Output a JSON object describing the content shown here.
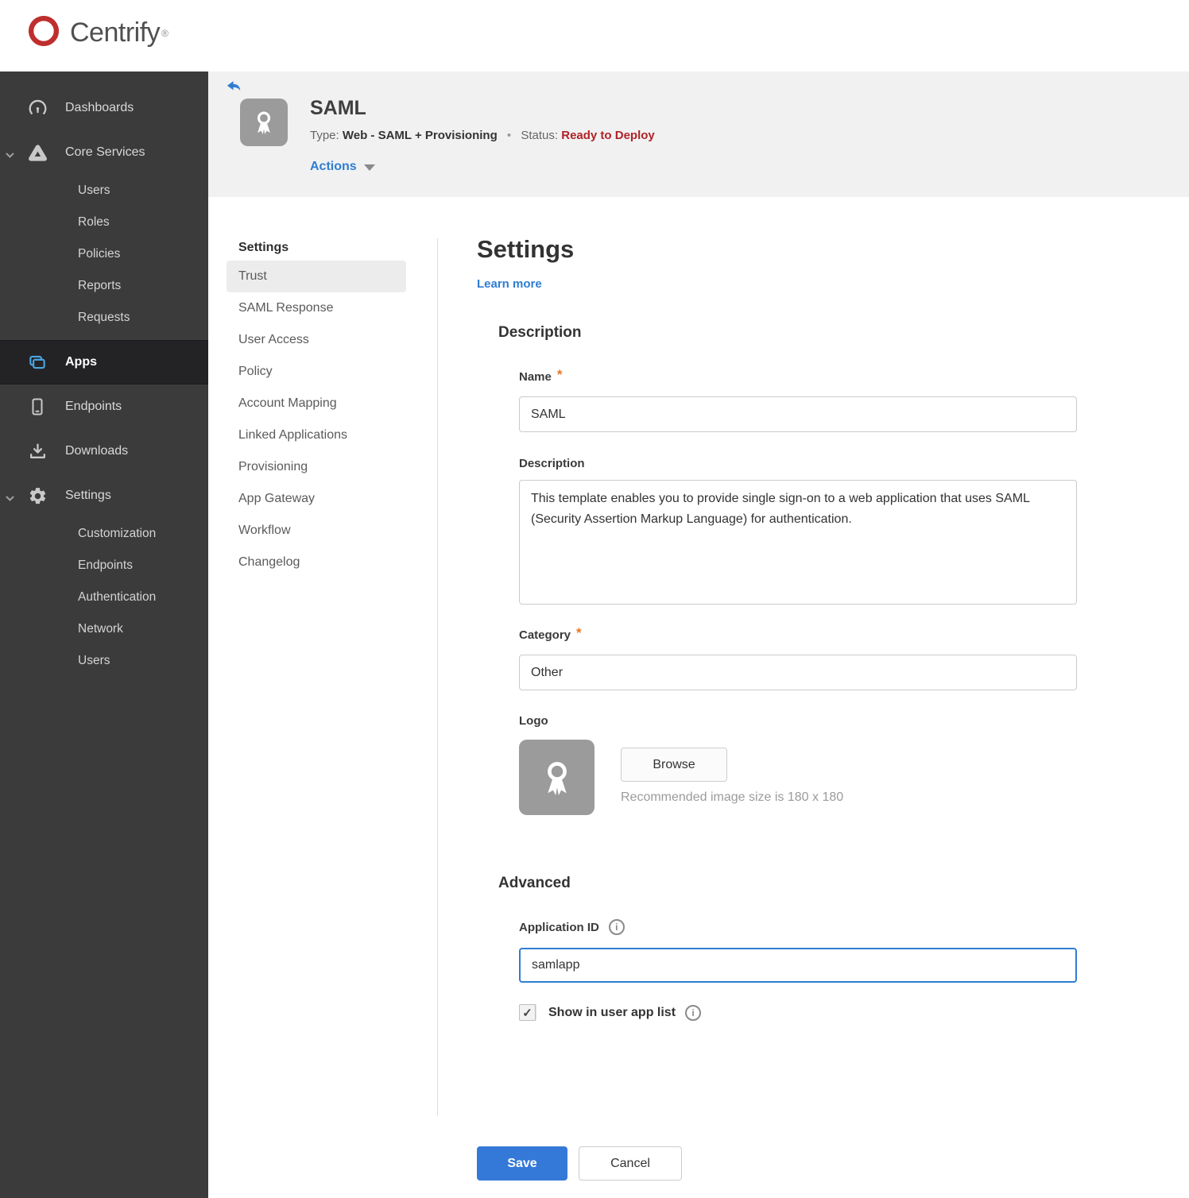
{
  "colors": {
    "accent_blue": "#2f7dd1",
    "save_blue": "#3579d8",
    "status_red": "#b02225",
    "sidebar_bg": "#3b3b3c",
    "sidebar_active_bg": "#232325",
    "apps_icon_blue": "#4ba4e3",
    "brand_red": "#bf2e2e",
    "required_orange": "#e87722",
    "band_gray": "#f1f1f2",
    "tile_gray": "#9b9b9b"
  },
  "brand": {
    "name": "Centrify",
    "trademark": "®"
  },
  "icons": {
    "brand": "centrify-swirl-icon",
    "back": "back-arrow-icon",
    "dashboards": "gauge-icon",
    "core_services": "triangle-network-icon",
    "apps": "stacked-windows-icon",
    "endpoints": "smartphone-icon",
    "downloads": "download-icon",
    "settings": "gear-icon",
    "app_logo": "ribbon-award-icon",
    "info": "info-circle-icon",
    "caret": "caret-down-icon",
    "chevron": "chevron-down-icon"
  },
  "sidebar": {
    "items": [
      {
        "label": "Dashboards"
      },
      {
        "label": "Core Services"
      },
      {
        "label": "Users"
      },
      {
        "label": "Roles"
      },
      {
        "label": "Policies"
      },
      {
        "label": "Reports"
      },
      {
        "label": "Requests"
      },
      {
        "label": "Apps"
      },
      {
        "label": "Endpoints"
      },
      {
        "label": "Downloads"
      },
      {
        "label": "Settings"
      },
      {
        "label": "Customization"
      },
      {
        "label": "Endpoints"
      },
      {
        "label": "Authentication"
      },
      {
        "label": "Network"
      },
      {
        "label": "Users"
      }
    ]
  },
  "header": {
    "title": "SAML",
    "type_label": "Type:",
    "type_value": "Web - SAML + Provisioning",
    "separator": "•",
    "status_label": "Status:",
    "status_value": "Ready to Deploy",
    "actions_label": "Actions"
  },
  "subnav": {
    "heading": "Settings",
    "items": [
      {
        "label": "Trust"
      },
      {
        "label": "SAML Response"
      },
      {
        "label": "User Access"
      },
      {
        "label": "Policy"
      },
      {
        "label": "Account Mapping"
      },
      {
        "label": "Linked Applications"
      },
      {
        "label": "Provisioning"
      },
      {
        "label": "App Gateway"
      },
      {
        "label": "Workflow"
      },
      {
        "label": "Changelog"
      }
    ]
  },
  "main": {
    "title": "Settings",
    "learn_more": "Learn more",
    "required_marker": "*",
    "description_section": {
      "heading": "Description",
      "name_label": "Name",
      "name_value": "SAML",
      "description_label": "Description",
      "description_value": "This template enables you to provide single sign-on to a web application that uses SAML (Security Assertion Markup Language) for authentication.",
      "category_label": "Category",
      "category_value": "Other",
      "logo_label": "Logo",
      "browse_label": "Browse",
      "recommended_text": "Recommended image size is 180 x 180"
    },
    "advanced_section": {
      "heading": "Advanced",
      "app_id_label": "Application ID",
      "app_id_value": "samlapp",
      "show_in_list_label": "Show in user app list",
      "checkbox_glyph": "✓",
      "info_glyph": "i"
    },
    "footer": {
      "save_label": "Save",
      "cancel_label": "Cancel"
    }
  }
}
